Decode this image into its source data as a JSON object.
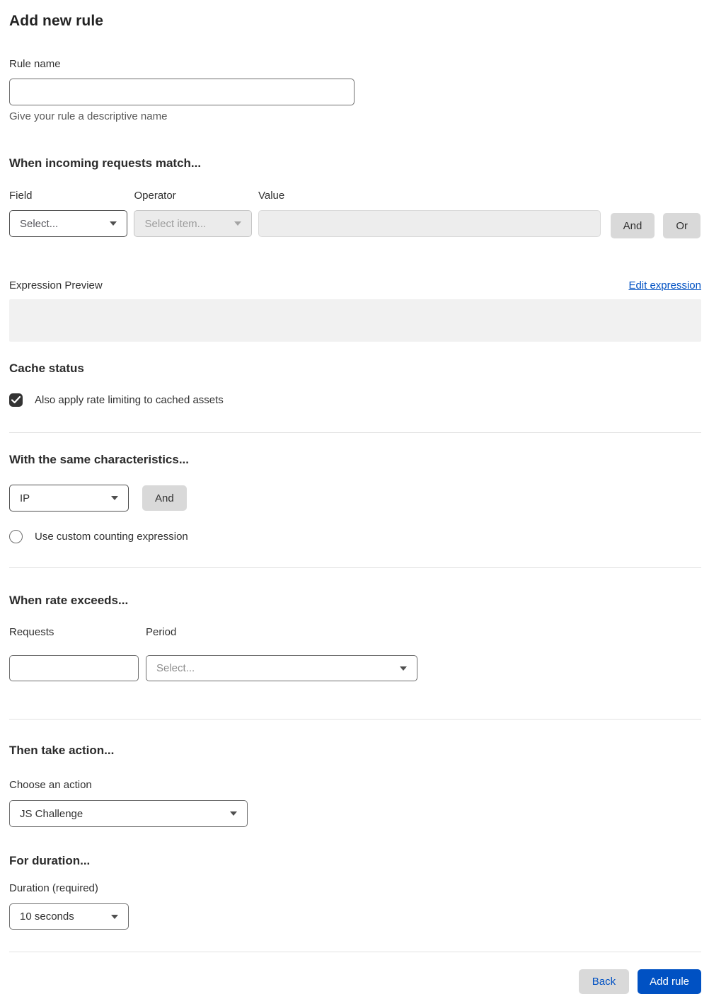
{
  "page": {
    "title": "Add new rule"
  },
  "rule_name": {
    "label": "Rule name",
    "value": "",
    "helper": "Give your rule a descriptive name"
  },
  "match_section": {
    "heading": "When incoming requests match...",
    "field": {
      "label": "Field",
      "selected": "Select..."
    },
    "operator": {
      "label": "Operator",
      "selected": "Select item..."
    },
    "value": {
      "label": "Value",
      "value": ""
    },
    "and_button": "And",
    "or_button": "Or",
    "expression_preview_label": "Expression Preview",
    "edit_expression_link": "Edit expression",
    "expression_value": ""
  },
  "cache_section": {
    "heading": "Cache status",
    "checkbox_label": "Also apply rate limiting to cached assets",
    "checked": true
  },
  "characteristics_section": {
    "heading": "With the same characteristics...",
    "characteristic_selected": "IP",
    "and_button": "And",
    "checkbox_label": "Use custom counting expression",
    "checked": false
  },
  "rate_section": {
    "heading": "When rate exceeds...",
    "requests": {
      "label": "Requests",
      "value": ""
    },
    "period": {
      "label": "Period",
      "selected": "Select..."
    }
  },
  "action_section": {
    "heading": "Then take action...",
    "label": "Choose an action",
    "selected": "JS Challenge"
  },
  "duration_section": {
    "heading": "For duration...",
    "label": "Duration (required)",
    "selected": "10 seconds"
  },
  "footer": {
    "back_button": "Back",
    "add_rule_button": "Add rule"
  },
  "colors": {
    "accent_blue": "#0051c3",
    "button_gray": "#d9d9d9",
    "text_dark": "#313131",
    "helper_gray": "#595959",
    "disabled_bg": "#ebebeb",
    "preview_bg": "#f1f1f1",
    "checkbox_checked": "#333333"
  },
  "icons": {
    "dropdown_caret": "chevron-down-icon",
    "checkmark": "check-icon"
  }
}
